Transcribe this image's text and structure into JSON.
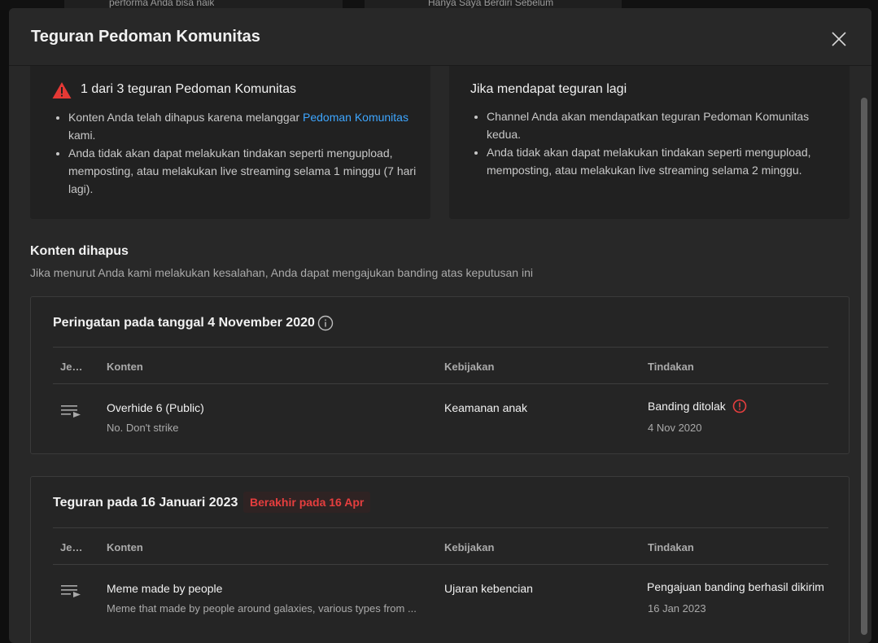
{
  "background": {
    "left_text": "performa Anda bisa naik",
    "right_text": "Hanya Saya Berdiri Sebelum"
  },
  "dialog": {
    "title": "Teguran Pedoman Komunitas",
    "close_icon": "close-icon"
  },
  "strike_status": {
    "heading": "1 dari 3 teguran Pedoman Komunitas",
    "icon": "warning-triangle-icon",
    "icon_color": "#e53935",
    "bullet1_before_link": "Konten Anda telah dihapus karena melanggar ",
    "bullet1_link": "Pedoman Komunitas",
    "bullet1_after_link": " kami.",
    "bullet2": "Anda tidak akan dapat melakukan tindakan seperti mengupload, memposting, atau melakukan live streaming selama 1 minggu (7 hari lagi)."
  },
  "next_strike": {
    "heading": "Jika mendapat teguran lagi",
    "bullet1": "Channel Anda akan mendapatkan teguran Pedoman Komunitas kedua.",
    "bullet2": "Anda tidak akan dapat melakukan tindakan seperti mengupload, memposting, atau melakukan live streaming selama 2 minggu."
  },
  "removed_content": {
    "title": "Konten dihapus",
    "subtitle": "Jika menurut Anda kami melakukan kesalahan, Anda dapat mengajukan banding atas keputusan ini"
  },
  "columns": {
    "type": "Je…",
    "content": "Konten",
    "policy": "Kebijakan",
    "action": "Tindakan"
  },
  "warning_card": {
    "title": "Peringatan pada tanggal 4 November 2020",
    "row": {
      "type_icon": "playlist-icon",
      "content_title": "Overhide 6 (Public)",
      "content_desc": "No. Don't strike",
      "policy": "Keamanan anak",
      "action": "Banding ditolak",
      "action_icon": "alert-circle-icon",
      "date": "4 Nov 2020"
    }
  },
  "strike_card": {
    "title": "Teguran pada 16 Januari 2023",
    "badge": "Berakhir pada 16 Apr",
    "row": {
      "type_icon": "playlist-icon",
      "content_title": "Meme made by people",
      "content_desc": "Meme that made by people around galaxies, various types from ...",
      "policy": "Ujaran kebencian",
      "action": "Pengajuan banding berhasil dikirim",
      "date": "16 Jan 2023"
    }
  },
  "colors": {
    "accent_link": "#3ea6ff",
    "error_red": "#e53e3e"
  }
}
